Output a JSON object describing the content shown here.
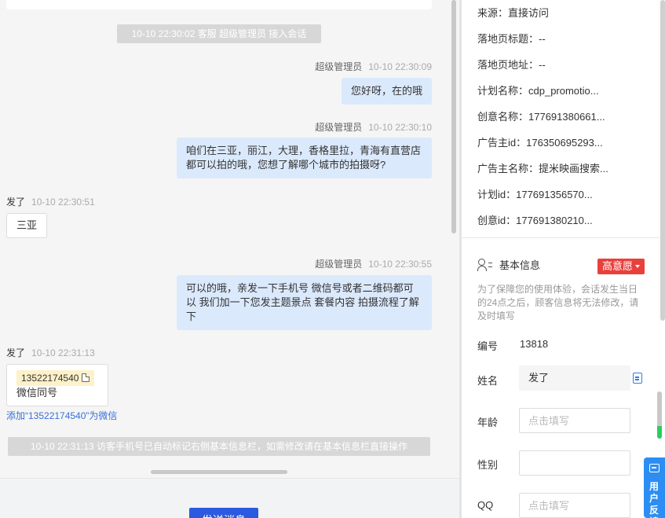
{
  "chat": {
    "system_join": "10-10 22:30:02 客服 超级管理员 接入会话",
    "messages": [
      {
        "sender": "超级管理员",
        "time": "10-10 22:30:09",
        "text": "您好呀，在的哦"
      },
      {
        "sender": "超级管理员",
        "time": "10-10 22:30:10",
        "text": "咱们在三亚，丽江，大理，香格里拉，青海有直营店都可以拍的哦，您想了解哪个城市的拍摄呀?"
      },
      {
        "sender": "发了",
        "time": "10-10 22:30:51",
        "text": "三亚"
      },
      {
        "sender": "超级管理员",
        "time": "10-10 22:30:55",
        "text": "可以的哦，亲发一下手机号 微信号或者二维码都可以 我们加一下您发主题景点 套餐内容 拍摄流程了解下"
      },
      {
        "sender": "发了",
        "time": "10-10 22:31:13",
        "phone": "13522174540",
        "sub": "微信同号"
      }
    ],
    "add_wechat_link": "添加“13522174540”为微信",
    "system_auto_tag": "10-10 22:31:13 访客手机号已自动标记右侧基本信息栏，如需修改请在基本信息栏直接操作",
    "send_button": "发送消息"
  },
  "panel": {
    "source_rows": [
      "来源：直接访问",
      "落地页标题：--",
      "落地页地址：--",
      "计划名称：cdp_promotio...",
      "创意名称：177691380661...",
      "广告主id：176350695293...",
      "广告主名称：提米映画搜索...",
      "计划id：177691356570...",
      "创意id：177691380210..."
    ],
    "basic_info_title": "基本信息",
    "intent_badge": "高意愿",
    "notice": "为了保障您的使用体验，会话发生当日的24点之后，顾客信息将无法修改，请及时填写",
    "fields": {
      "id_label": "编号",
      "id_value": "13818",
      "name_label": "姓名",
      "name_value": "发了",
      "age_label": "年龄",
      "age_placeholder": "点击填写",
      "gender_label": "性别",
      "gender_placeholder": "",
      "qq_label": "QQ",
      "qq_placeholder": "点击填写"
    }
  },
  "feedback_tab": "用户反馈",
  "colors": {
    "agent_bubble": "#dbe9fc",
    "send_button": "#2b5ae0",
    "intent_badge": "#e8413c",
    "link": "#3a6fd8",
    "feedback_tab": "#2c8ef2"
  }
}
